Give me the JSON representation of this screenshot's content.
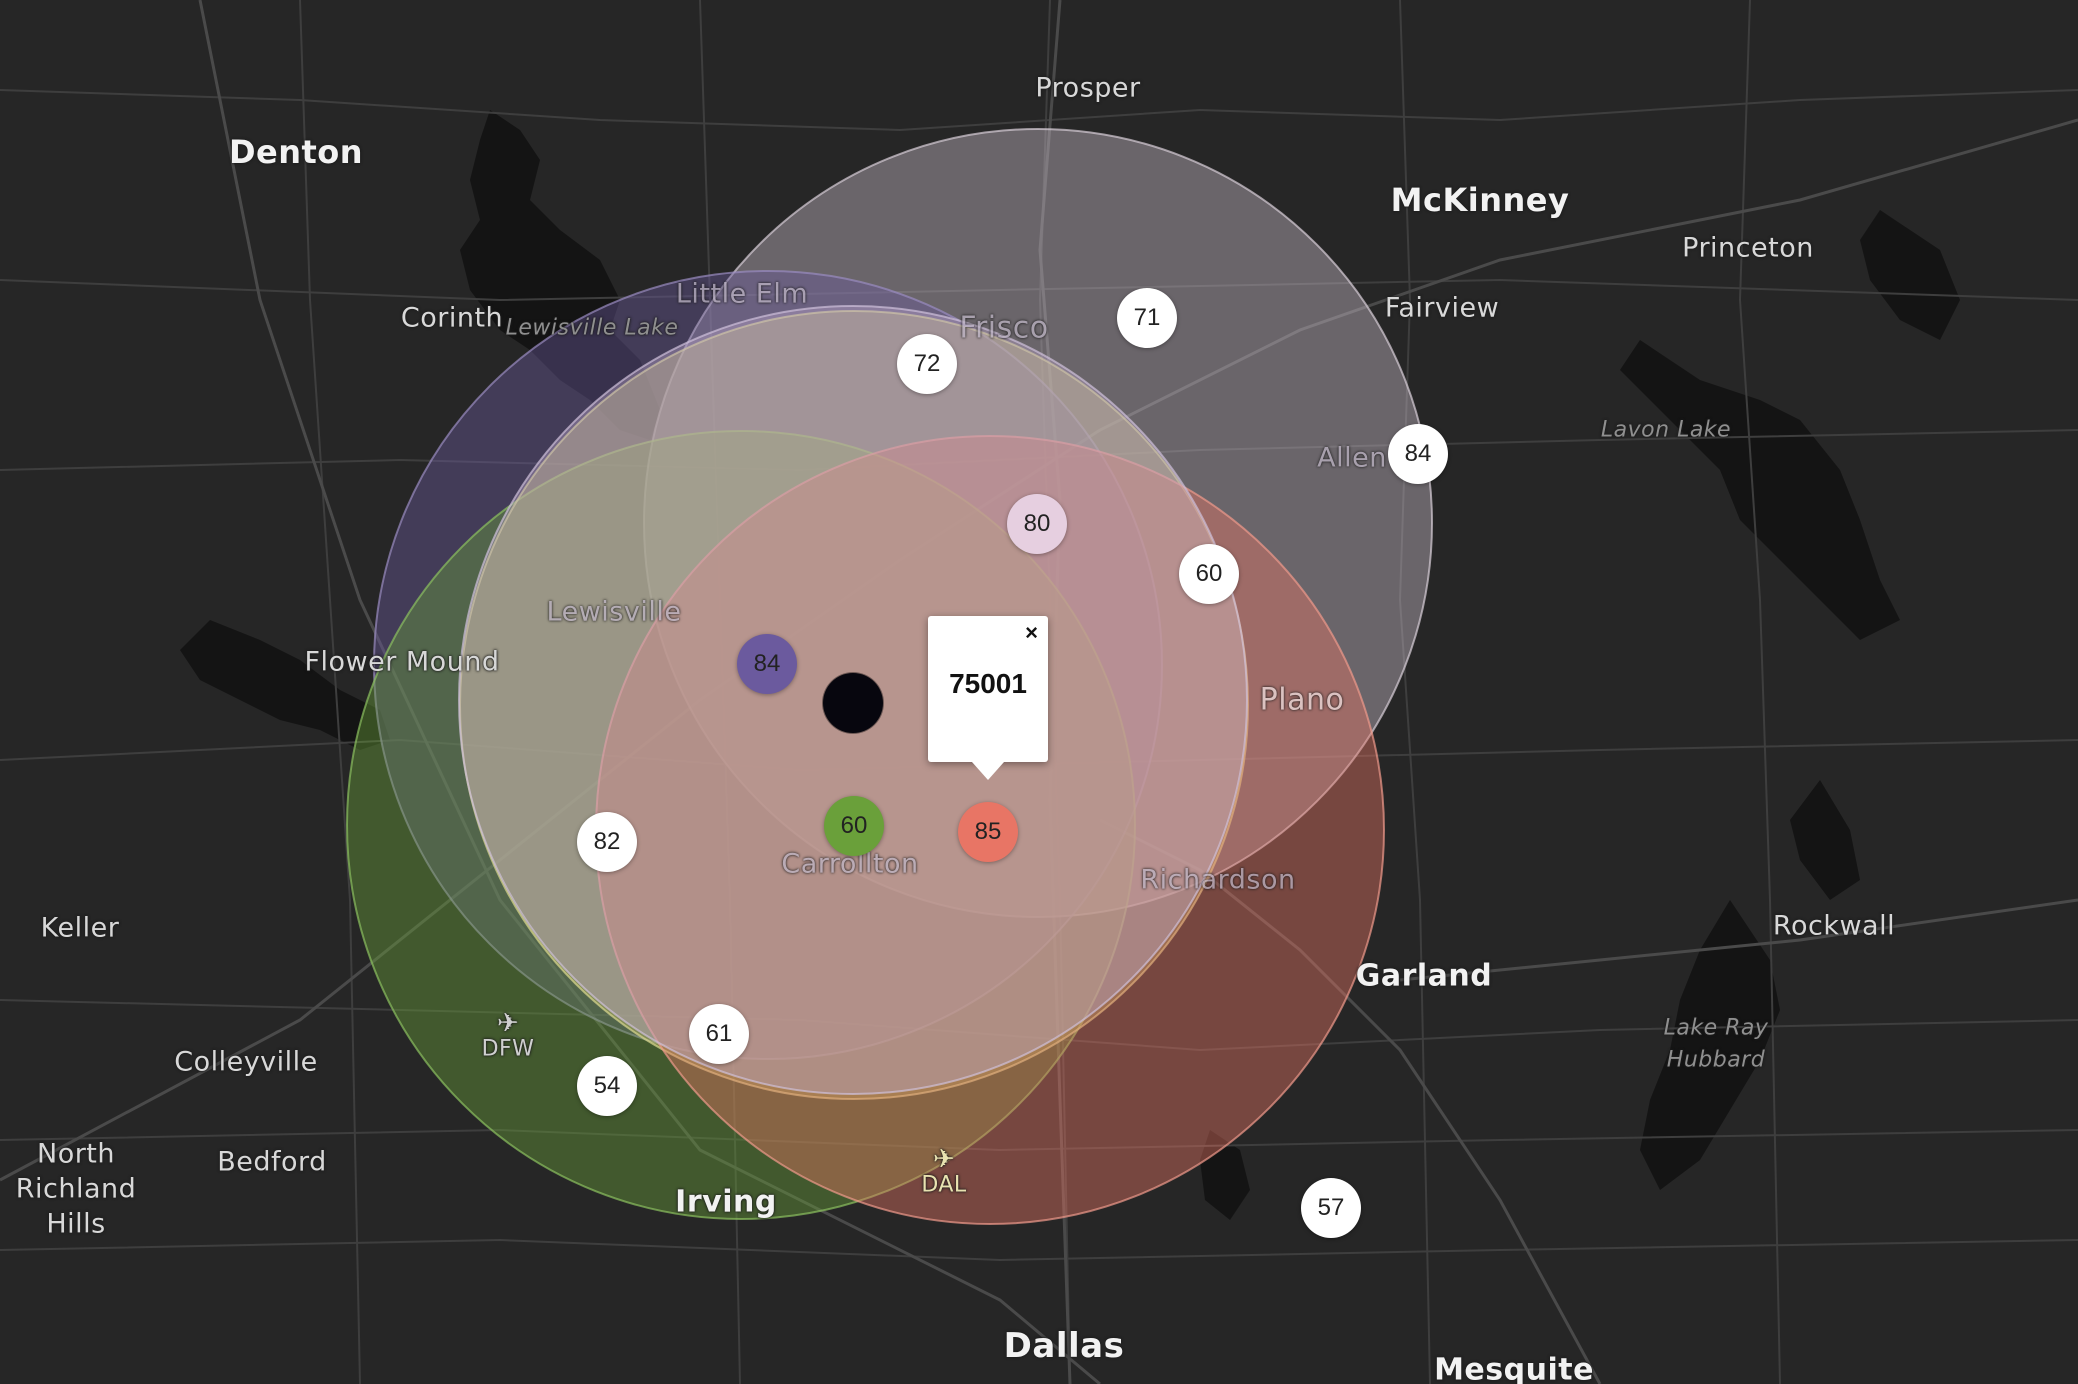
{
  "map": {
    "base_color": "#262626",
    "road_color": "#3e3e3e",
    "water_color": "#141414"
  },
  "places": {
    "denton": "Denton",
    "prosper": "Prosper",
    "mckinney": "McKinney",
    "princeton": "Princeton",
    "corinth": "Corinth",
    "lewisville_lake": "Lewisville Lake",
    "little_elm": "Little Elm",
    "frisco": "Frisco",
    "fairview": "Fairview",
    "lavon_lake": "Lavon Lake",
    "allen": "Allen",
    "lewisville": "Lewisville",
    "flower_mound": "Flower Mound",
    "plano": "Plano",
    "carrollton": "Carrollton",
    "richardson": "Richardson",
    "keller": "Keller",
    "rockwall": "Rockwall",
    "garland": "Garland",
    "lake_ray_hubbard_1": "Lake Ray",
    "lake_ray_hubbard_2": "Hubbard",
    "colleyville": "Colleyville",
    "north_richland_1": "North",
    "north_richland_2": "Richland",
    "north_richland_3": "Hills",
    "bedford": "Bedford",
    "irving": "Irving",
    "dallas": "Dallas",
    "mesquite": "Mesquite"
  },
  "airports": {
    "dfw": {
      "code": "DFW",
      "icon": "airplane-icon"
    },
    "dal": {
      "code": "DAL",
      "icon": "airplane-icon"
    }
  },
  "radius_circles": [
    {
      "name": "circle-gray",
      "color": "#c8bcc8"
    },
    {
      "name": "circle-purple",
      "color": "#6b5a9e"
    },
    {
      "name": "circle-green",
      "color": "#6aa03a"
    },
    {
      "name": "circle-olive",
      "color": "#c8c36a"
    },
    {
      "name": "circle-red",
      "color": "#e87565"
    },
    {
      "name": "circle-lilac",
      "color": "#b9a4c8"
    }
  ],
  "markers": {
    "m71": "71",
    "m72": "72",
    "m84_allen": "84",
    "m80": "80",
    "m60_plano": "60",
    "m84_purple": "84",
    "m60_green": "60",
    "m85_red": "85",
    "m82": "82",
    "m61": "61",
    "m54": "54",
    "m57": "57"
  },
  "marker_colors": {
    "default": "#ffffff",
    "m80": "#e6cfe0",
    "m84_purple": "#6b5a9e",
    "m60_green": "#6aa03a",
    "m85_red": "#e87565"
  },
  "popup": {
    "title": "75001",
    "close_label": "×"
  }
}
